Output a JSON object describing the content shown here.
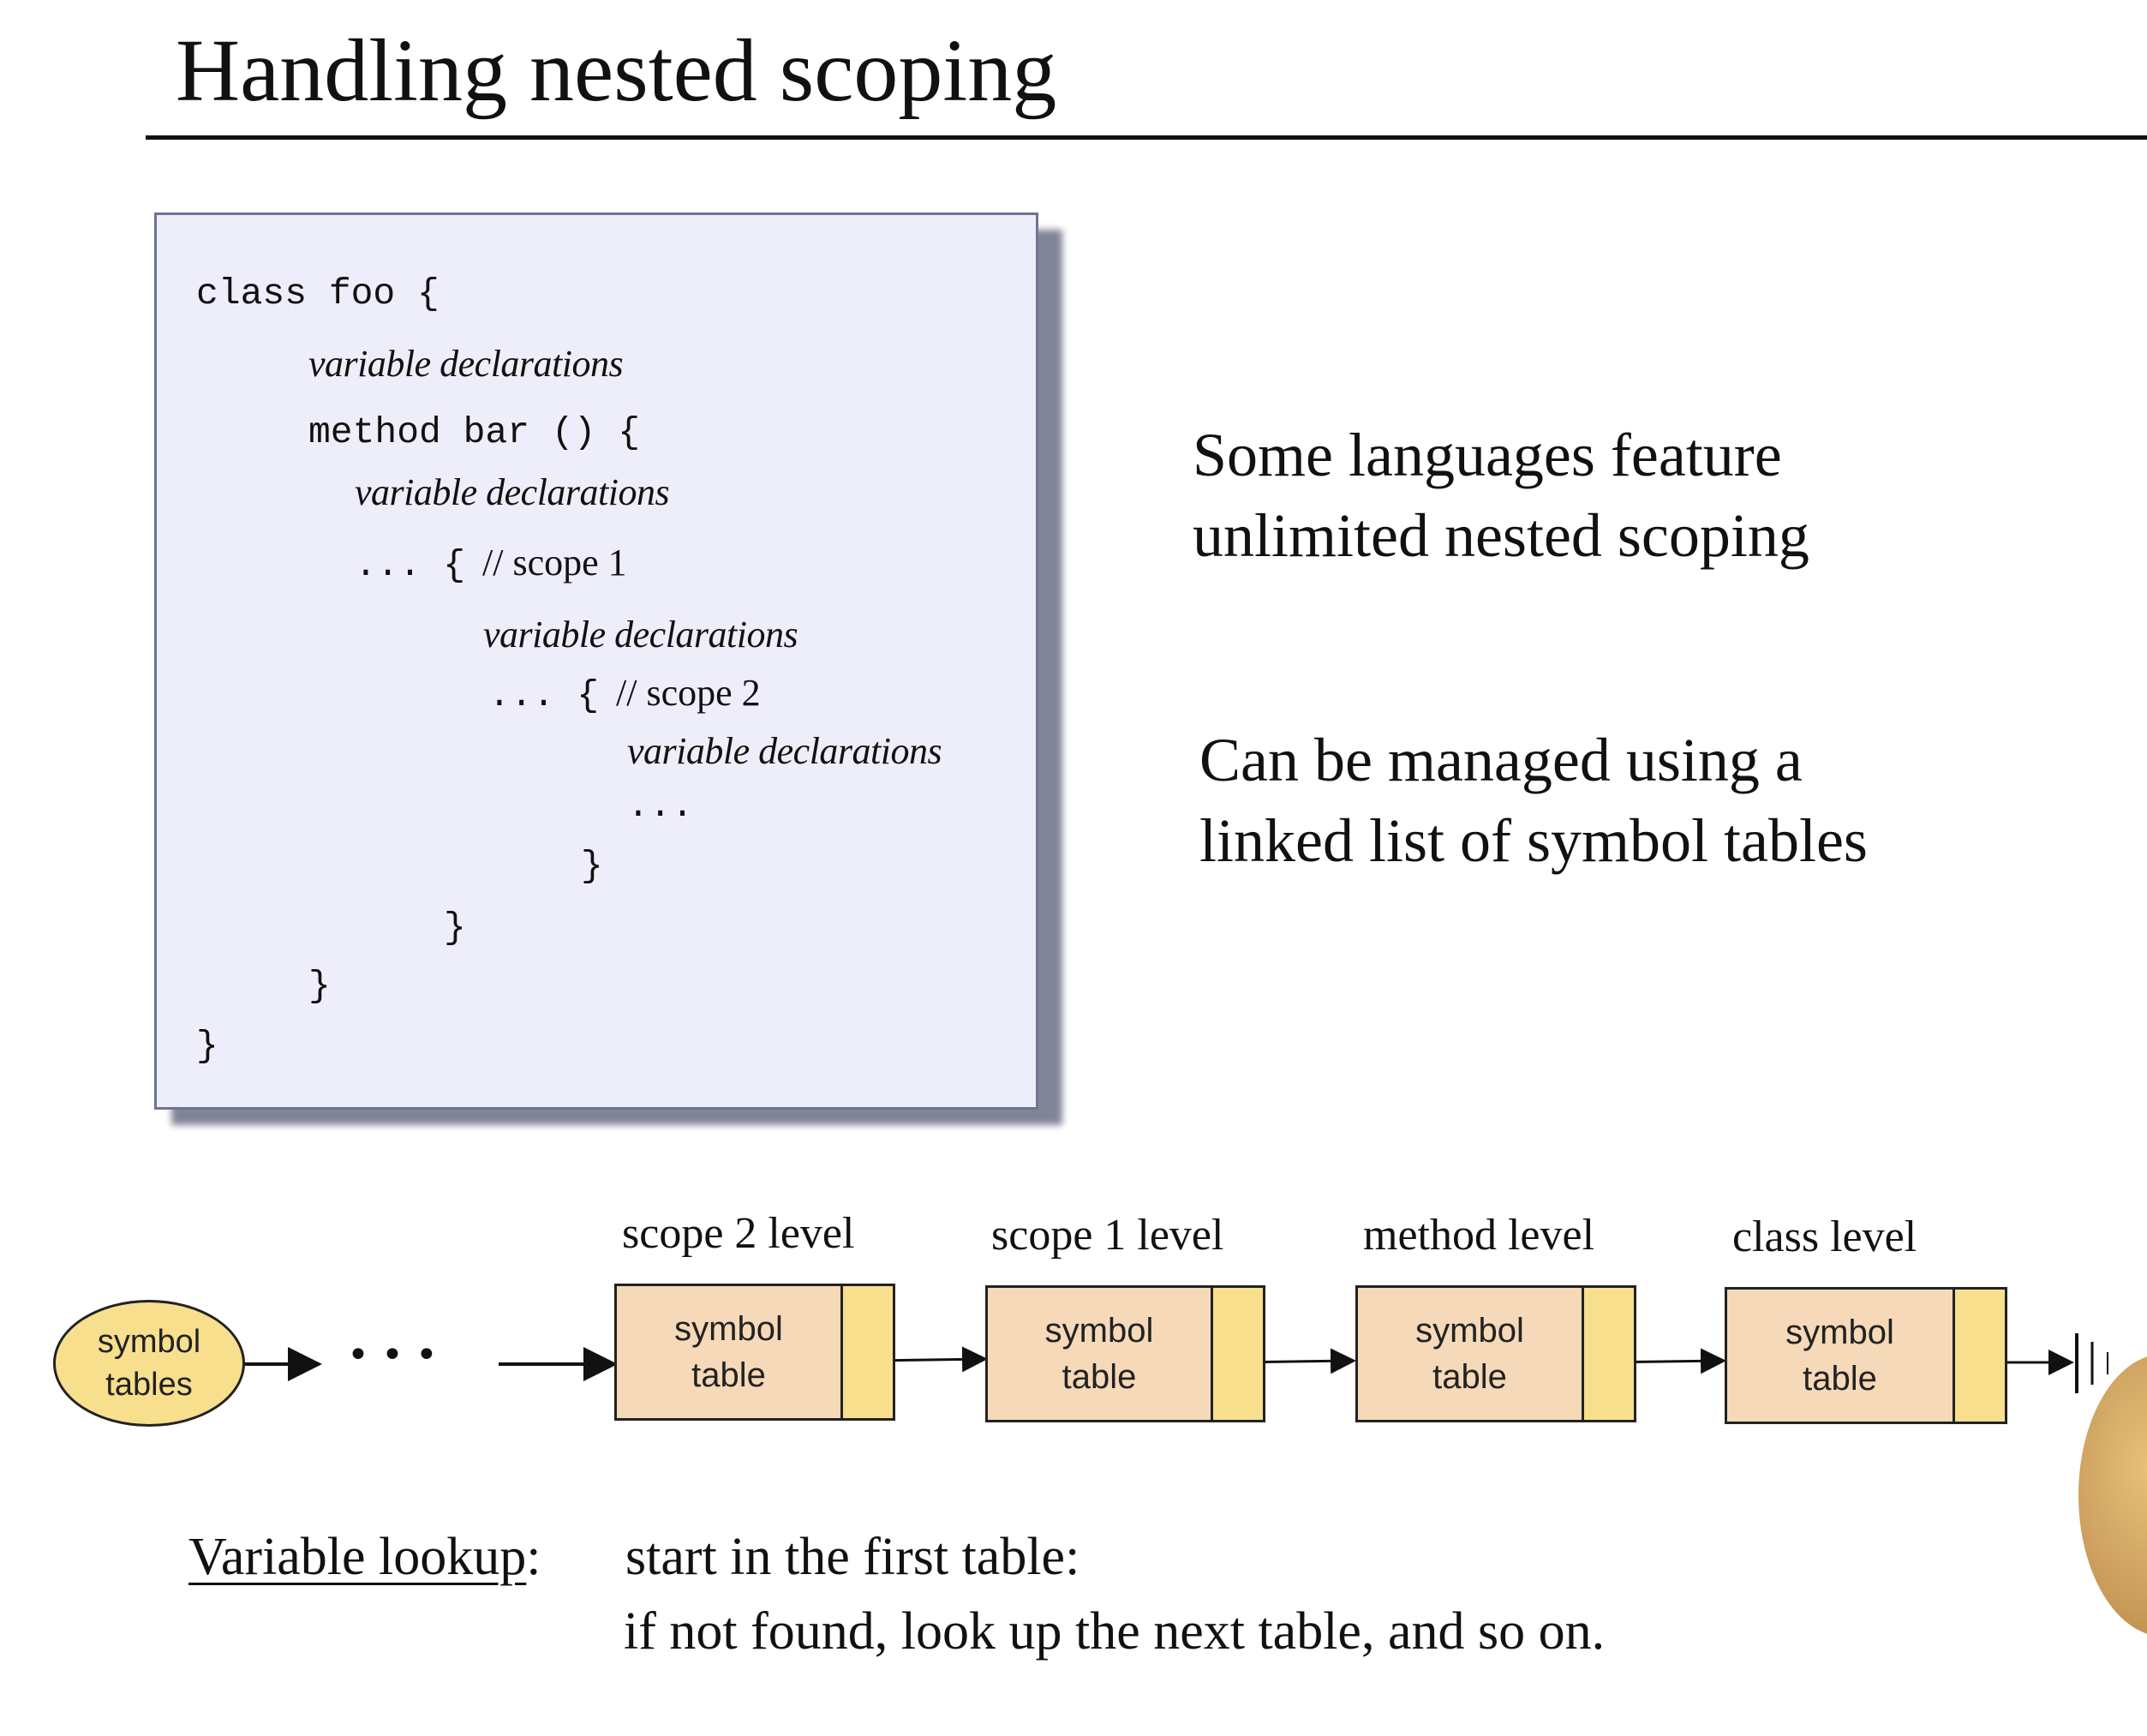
{
  "title": "Handling nested scoping",
  "code": {
    "l1": "class foo {",
    "l2": "variable declarations",
    "l3": "method bar () {",
    "l4": "variable declarations",
    "l5_code": "... {",
    "l5_comment": "// scope 1",
    "l6": "variable declarations",
    "l7_code": "... {",
    "l7_comment": "// scope 2",
    "l8": "variable declarations",
    "l9": "...",
    "l10": "}",
    "l11": "}",
    "l12": "}",
    "l13": "}"
  },
  "points": {
    "p1_line1": "Some languages feature",
    "p1_line2": "unlimited nested scoping",
    "p2_line1": "Can be managed using a",
    "p2_line2": "linked list of symbol tables"
  },
  "diagram": {
    "head_label": "symbol\ntables",
    "ellipsis": "• • •",
    "nodes": [
      {
        "level": "scope 2 level",
        "label": "symbol\ntable"
      },
      {
        "level": "scope 1 level",
        "label": "symbol\ntable"
      },
      {
        "level": "method level",
        "label": "symbol\ntable"
      },
      {
        "level": "class level",
        "label": "symbol\ntable"
      }
    ]
  },
  "lookup": {
    "label": "Variable lookup",
    "colon": ":",
    "line1": "start in the first table:",
    "line2": "if not found, look up the next table, and so on."
  },
  "colors": {
    "code_bg": "#eeeefa",
    "node_fill": "#f5d9b8",
    "pointer_fill": "#f8df8e"
  }
}
